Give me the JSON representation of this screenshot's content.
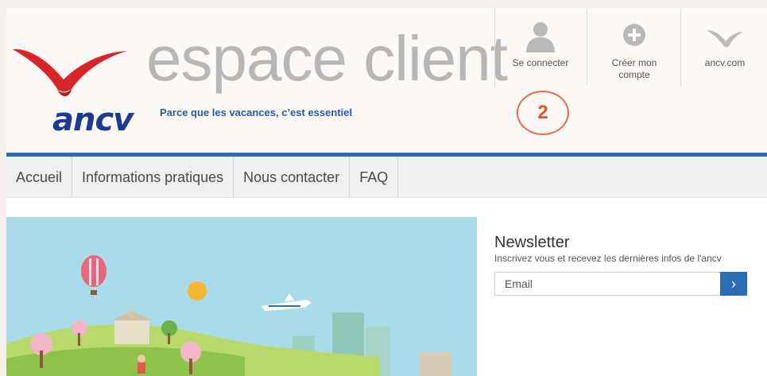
{
  "header": {
    "logo_text": "ancv",
    "brand_title": "espace client",
    "tagline": "Parce que les vacances, c’est essentiel",
    "actions": [
      {
        "label": "Se connecter",
        "icon": "user-icon"
      },
      {
        "label": "Créer mon compte",
        "icon": "plus-circle-icon"
      },
      {
        "label": "ancv.com",
        "icon": "bird-icon"
      }
    ],
    "badge": "2"
  },
  "nav": {
    "items": [
      {
        "label": "Accueil"
      },
      {
        "label": "Informations pratiques"
      },
      {
        "label": "Nous contacter"
      },
      {
        "label": "FAQ"
      }
    ]
  },
  "newsletter": {
    "title": "Newsletter",
    "description": "Inscrivez vous et recevez les dernières infos de l'ancv",
    "input_placeholder": "Email",
    "submit_glyph": "›"
  },
  "colors": {
    "brand_blue": "#2d6db4",
    "logo_red": "#d8252a",
    "logo_navy": "#1c3a8f",
    "badge_orange": "#e86a4a"
  }
}
